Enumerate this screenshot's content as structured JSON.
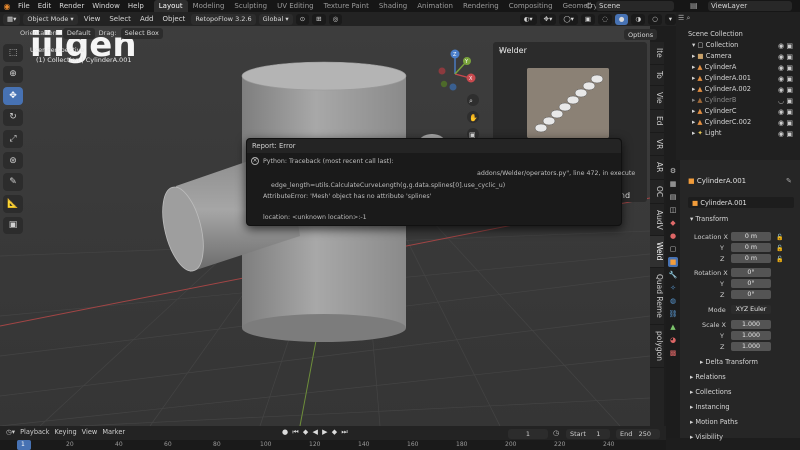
{
  "topbar": {
    "menus": [
      "File",
      "Edit",
      "Render",
      "Window",
      "Help"
    ],
    "workspaces": [
      "Layout",
      "Modeling",
      "Sculpting",
      "UV Editing",
      "Texture Paint",
      "Shading",
      "Animation",
      "Rendering",
      "Compositing",
      "Geometry Nodes"
    ],
    "active_workspace": "Layout",
    "scene": "Scene",
    "viewlayer": "ViewLayer"
  },
  "viewport_header": {
    "mode": "Object Mode",
    "menus": [
      "View",
      "Select",
      "Add",
      "Object"
    ],
    "addon": "RetopoFlow 3.2.6",
    "orientation": "Global",
    "options": "Options"
  },
  "tool_header": {
    "orientation_label": "Orientation:",
    "orientation_value": "Default",
    "drag_label": "Drag:",
    "drag_value": "Select Box"
  },
  "viewport": {
    "overlay_title": "User Perspective",
    "overlay_subtitle": "(1) Collection | CylinderA.001",
    "watermark": "iiigen",
    "gizmo": {
      "x": "X",
      "y": "Y",
      "z": "Z"
    }
  },
  "npanel": {
    "title": "Welder",
    "button_label": "Weld",
    "tabs": [
      "Ite",
      "To",
      "Vie",
      "Ed",
      "VR",
      "AR",
      "OC",
      "AudV",
      "Weld",
      "Quad Reme",
      "polygon"
    ],
    "active_tab": "Weld"
  },
  "report": {
    "title": "Report: Error",
    "line1": "Python: Traceback (most recent call last):",
    "line2": "addons/Welder/operators.py\", line 472, in execute",
    "line3": "edge_length=utils.CalculateCurveLength(g,g.data.splines[0].use_cyclic_u)",
    "line4": "AttributeError: 'Mesh' object has no attribute 'splines'",
    "line5": "location: <unknown location>:-1"
  },
  "outliner": {
    "root": "Scene Collection",
    "collection": "Collection",
    "items": [
      {
        "name": "Camera"
      },
      {
        "name": "CylinderA"
      },
      {
        "name": "CylinderA.001"
      },
      {
        "name": "CylinderA.002"
      },
      {
        "name": "CylinderB"
      },
      {
        "name": "CylinderC"
      },
      {
        "name": "CylinderC.002"
      },
      {
        "name": "Light"
      }
    ]
  },
  "properties": {
    "object_name": "CylinderA.001",
    "object_field": "CylinderA.001",
    "transform_label": "Transform",
    "location_label": "Location X",
    "location": [
      "0 m",
      "0 m",
      "0 m"
    ],
    "rotation_label": "Rotation X",
    "rotation": [
      "0°",
      "0°",
      "0°"
    ],
    "mode_label": "Mode",
    "mode_value": "XYZ Euler",
    "scale_label": "Scale X",
    "scale": [
      "1.000",
      "1.000",
      "1.000"
    ],
    "axis_y": "Y",
    "axis_z": "Z",
    "sections": [
      "Delta Transform",
      "Relations",
      "Collections",
      "Instancing",
      "Motion Paths",
      "Visibility"
    ]
  },
  "timeline": {
    "menus": [
      "Playback",
      "Keying",
      "View",
      "Marker"
    ],
    "current_frame": "1",
    "start_label": "Start",
    "start": "1",
    "end_label": "End",
    "end": "250",
    "ticks": [
      "1",
      "20",
      "40",
      "60",
      "80",
      "100",
      "120",
      "140",
      "160",
      "180",
      "200",
      "220",
      "240"
    ]
  },
  "colors": {
    "accent": "#4772b3",
    "error": "#c8c8c8",
    "selected_text": "#7ab0ff"
  }
}
